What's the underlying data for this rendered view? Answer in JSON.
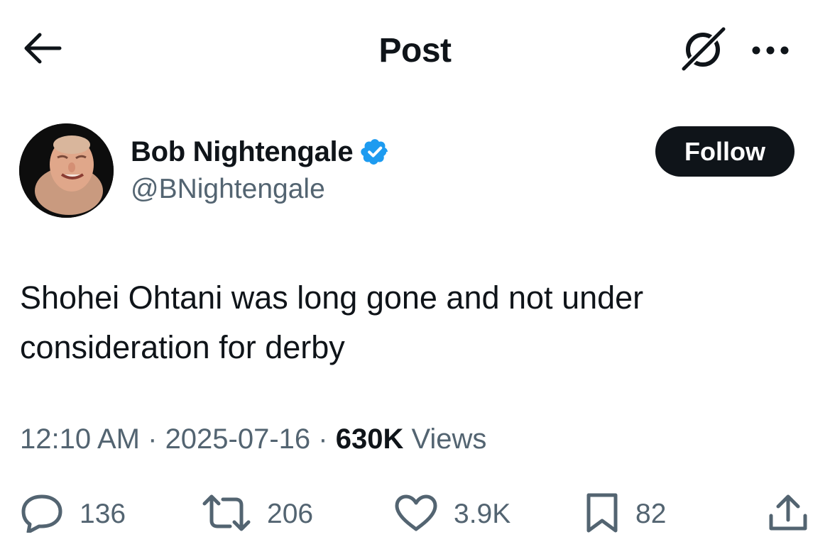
{
  "header": {
    "title": "Post",
    "back_icon": "arrow-left-icon",
    "grok_icon": "grok-icon",
    "more_icon": "more-horizontal-icon"
  },
  "author": {
    "name": "Bob Nightengale",
    "handle": "@BNightengale",
    "verified": true,
    "verified_color": "#1d9bf0",
    "follow_label": "Follow"
  },
  "tweet": {
    "text_line1": "Shohei Ohtani was long gone and not under",
    "text_line2": "consideration for derby"
  },
  "meta": {
    "time": "12:10 AM",
    "sep1": " · ",
    "date": "2025-07-16",
    "sep2": " · ",
    "views_count": "630K",
    "views_label": " Views"
  },
  "actions": {
    "replies": "136",
    "reposts": "206",
    "likes": "3.9K",
    "bookmarks": "82"
  },
  "colors": {
    "text_primary": "#0f1419",
    "text_secondary": "#536471",
    "follow_bg": "#0f1419"
  }
}
